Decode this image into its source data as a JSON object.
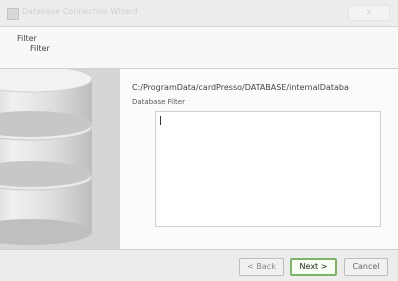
{
  "window": {
    "title": "Database Connection Wizard",
    "close_label": "X"
  },
  "header": {
    "title": "Filter",
    "subtitle": "Filter"
  },
  "content": {
    "path": "C:/ProgramData/cardPresso/DATABASE/internalDataba",
    "filter_label": "Database Filter",
    "filter_value": ""
  },
  "footer": {
    "back_label": "< Back",
    "next_label": "Next >",
    "cancel_label": "Cancel"
  },
  "colors": {
    "next_focus_border": "#7fb26a",
    "page_bg": "#fbfbfb",
    "graphic_bg": "#d9d9d9"
  }
}
